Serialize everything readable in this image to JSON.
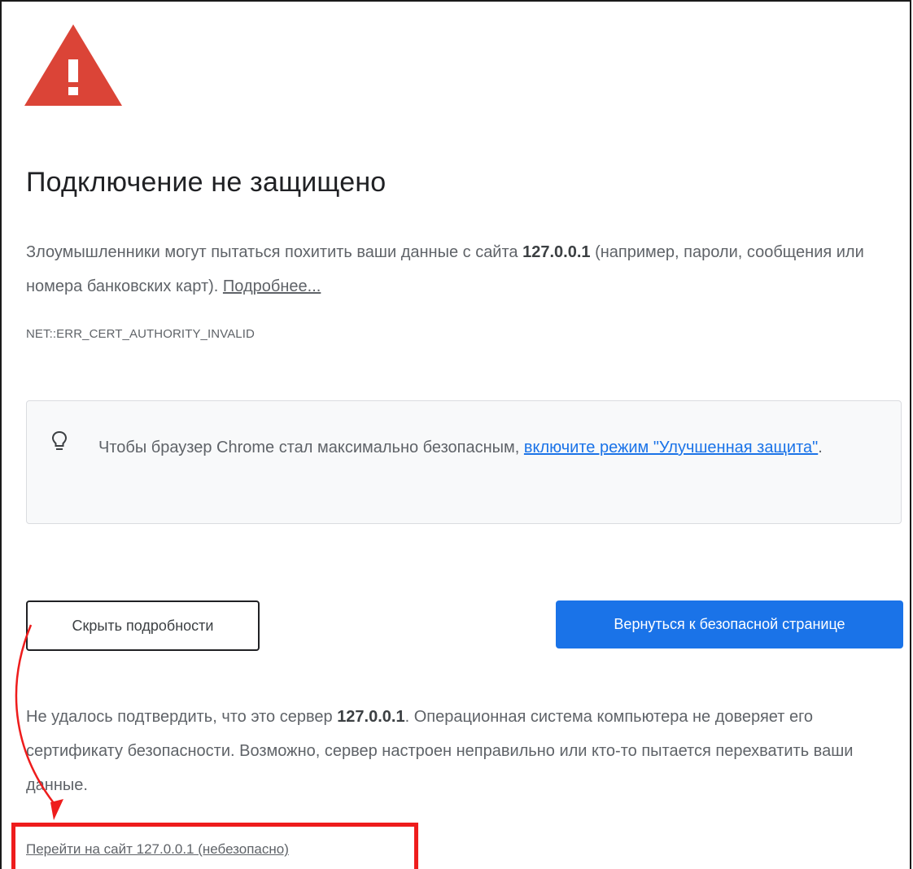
{
  "warning": {
    "title": "Подключение не защищено",
    "description_before": "Злоумышленники могут пытаться похитить ваши данные с сайта ",
    "site": "127.0.0.1",
    "description_after": " (например, пароли, сообщения или номера банковских карт). ",
    "learn_more": "Подробнее...",
    "error_code": "NET::ERR_CERT_AUTHORITY_INVALID"
  },
  "tip": {
    "text_before": "Чтобы браузер Chrome стал максимально безопасным, ",
    "link": "включите режим \"Улучшенная защита\"",
    "text_after": "."
  },
  "buttons": {
    "hide_details": "Скрыть подробности",
    "back_to_safety": "Вернуться к безопасной странице"
  },
  "details": {
    "text_before": "Не удалось подтвердить, что это сервер ",
    "site": "127.0.0.1",
    "text_after": ". Операционная система компьютера не доверяет его сертификату безопасности. Возможно, сервер настроен неправильно или кто-то пытается перехватить ваши данные."
  },
  "proceed_link": "Перейти на сайт 127.0.0.1 (небезопасно)",
  "colors": {
    "warning_red": "#db4437",
    "primary_blue": "#1a73e8",
    "annotation_red": "#ee1c1c"
  },
  "icons": {
    "warning": "warning-triangle-icon",
    "tip": "lightbulb-icon"
  }
}
